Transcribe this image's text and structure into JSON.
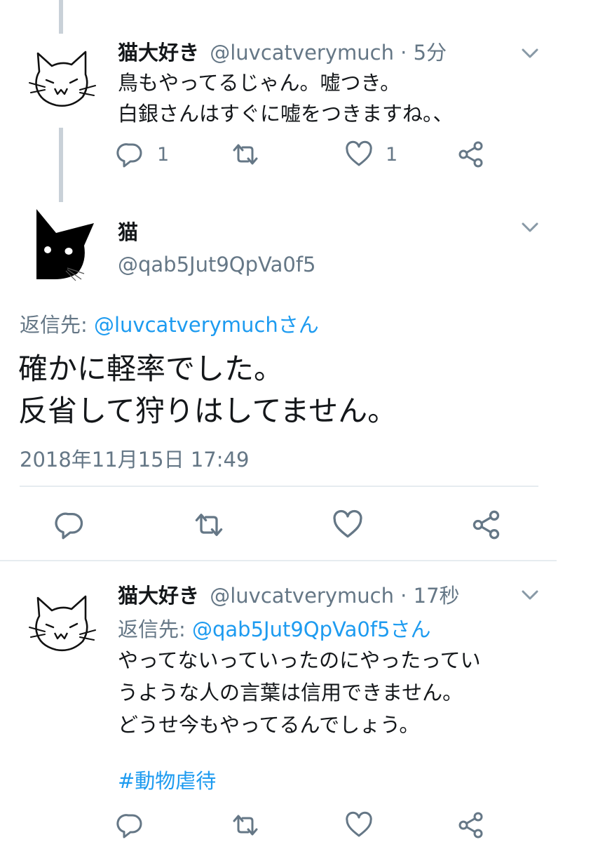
{
  "tweet1": {
    "name": "猫大好き",
    "handle": "@luvcatverymuch",
    "separator": " · ",
    "time": "5分",
    "lines": [
      "鳥もやってるじゃん。嘘つき。",
      "白銀さんはすぐに嘘をつきますね。、"
    ],
    "reply_count": "1",
    "like_count": "1"
  },
  "tweet2": {
    "name": "猫",
    "handle": "@qab5Jut9QpVa0f5",
    "reply_to_prefix": "返信先: ",
    "reply_to_handle": "@luvcatverymuchさん",
    "lines": [
      "確かに軽率でした。",
      "反省して狩りはしてません。"
    ],
    "timestamp": "2018年11月15日 17:49"
  },
  "tweet3": {
    "name": "猫大好き",
    "handle": "@luvcatverymuch",
    "separator": " · ",
    "time": "17秒",
    "reply_to_prefix": "返信先: ",
    "reply_to_handle": "@qab5Jut9QpVa0f5さん",
    "lines": [
      "やってないっていったのにやったってい",
      "うような人の言葉は信用できません。",
      "どうせ今もやってるんでしょう。"
    ],
    "hashtag": "#動物虐待"
  },
  "icons": [
    "reply-icon",
    "retweet-icon",
    "like-icon",
    "share-icon",
    "chevron-down-icon"
  ],
  "colors": {
    "accent": "#1d9bf0",
    "muted": "#657786",
    "thread_line": "#c9d1d8"
  }
}
